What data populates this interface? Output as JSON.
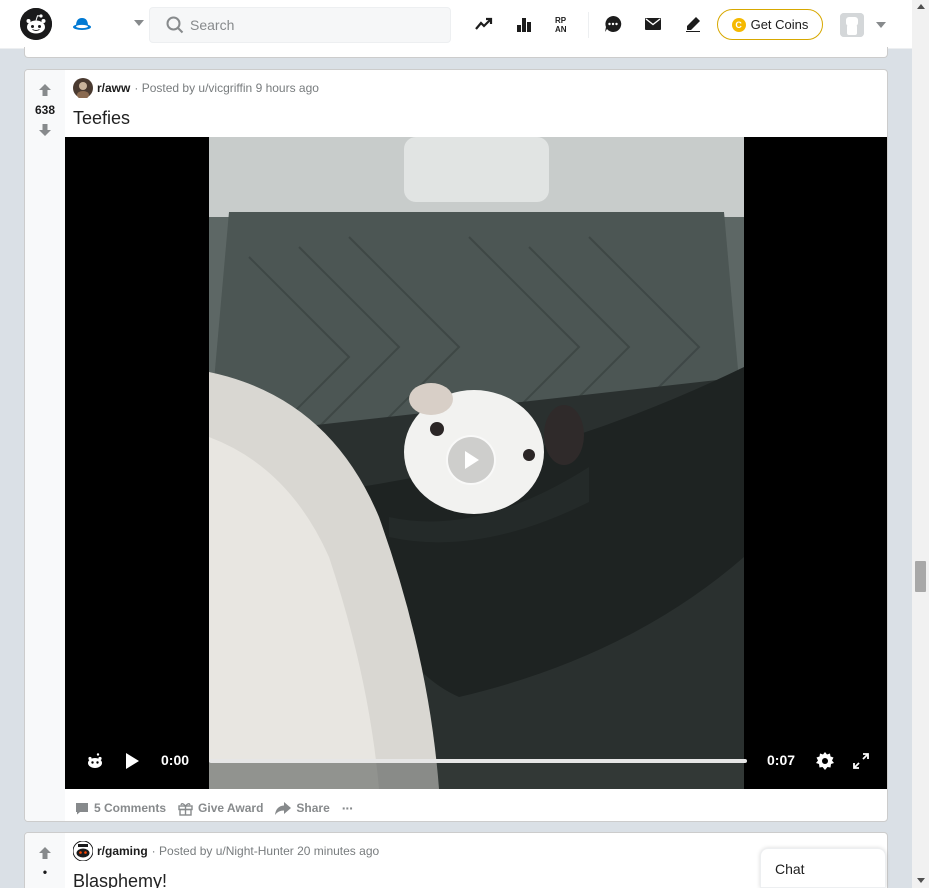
{
  "header": {
    "search_placeholder": "Search",
    "get_coins_label": "Get Coins",
    "coin_symbol": "C",
    "icons": [
      "popular-icon",
      "stats-icon",
      "rpan-icon",
      "chat-icon",
      "mail-icon",
      "create-post-icon"
    ]
  },
  "posts": [
    {
      "subreddit": "r/aww",
      "posted_by": "Posted by u/vicgriffin",
      "time_ago": "9 hours ago",
      "score": "638",
      "title": "Teefies",
      "video": {
        "current_time": "0:00",
        "duration": "0:07",
        "progress": 0.0
      },
      "actions": {
        "comments": "5 Comments",
        "award": "Give Award",
        "share": "Share",
        "more": "···"
      }
    },
    {
      "subreddit": "r/gaming",
      "posted_by": "Posted by u/Night-Hunter",
      "time_ago": "20 minutes ago",
      "score": "",
      "title": "Blasphemy!"
    }
  ],
  "chat": {
    "label": "Chat"
  },
  "colors": {
    "accent_blue": "#0079d3",
    "coin_gold": "#f5b900",
    "background": "#dae0e6"
  }
}
